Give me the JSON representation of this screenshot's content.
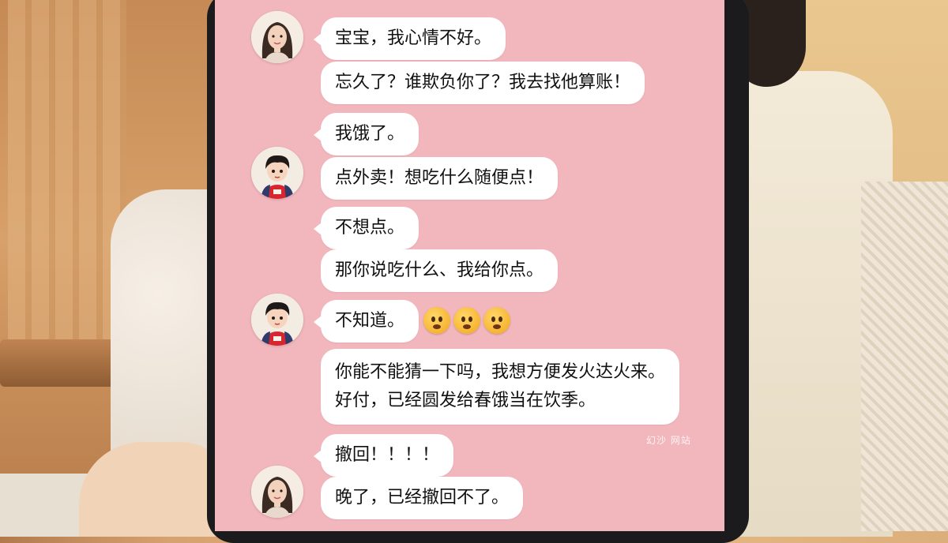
{
  "chat": {
    "messages": [
      {
        "sender": "girlfriend",
        "text": "宝宝，我心情不好。"
      },
      {
        "sender": "girlfriend",
        "text": "忘久了？谁欺负你了？我去找他算账！"
      },
      {
        "sender": "boyfriend",
        "text": "我饿了。"
      },
      {
        "sender": "boyfriend",
        "text": "点外卖！想吃什么随便点！"
      },
      {
        "sender": "girlfriend",
        "text": "不想点。"
      },
      {
        "sender": "girlfriend",
        "text": "那你说吃什么、我给你点。"
      },
      {
        "sender": "boyfriend",
        "text": "不知道。"
      },
      {
        "sender": "boyfriend",
        "text_lines": [
          "你能不能猜一下吗，我想方便发火达火来。",
          "好付，已经圆发给春饿当在饮季。"
        ]
      },
      {
        "sender": "girlfriend",
        "text": "撤回！！！！"
      },
      {
        "sender": "girlfriend",
        "text": "晚了，已经撤回不了。"
      }
    ],
    "emoji_reaction": [
      "worried-face-emoji",
      "worried-face-emoji",
      "worried-face-emoji"
    ],
    "watermark": "幻沙 网站"
  },
  "colors": {
    "chat_background": "#f2b6bd",
    "bubble": "#ffffff"
  }
}
